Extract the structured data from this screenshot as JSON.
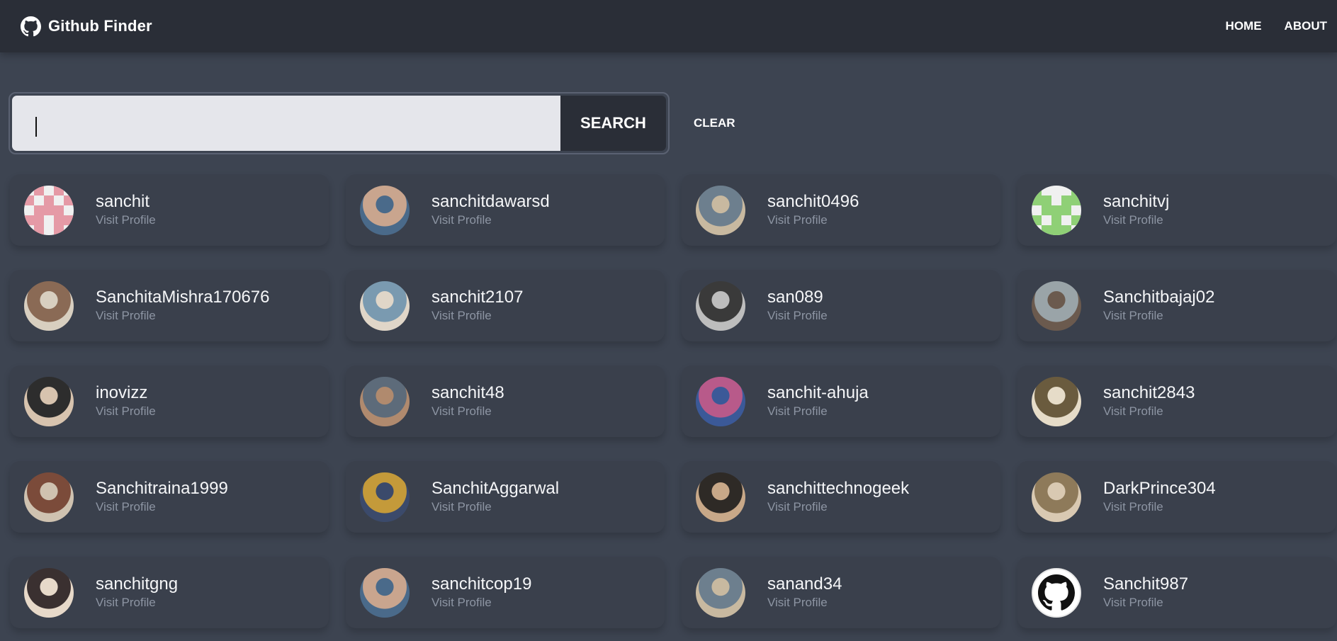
{
  "navbar": {
    "brand_icon": "github-icon",
    "title": "Github Finder",
    "links": [
      "HOME",
      "ABOUT"
    ]
  },
  "search": {
    "value": "",
    "placeholder": "",
    "button_label": "SEARCH",
    "clear_label": "CLEAR"
  },
  "users": [
    {
      "login": "sanchit",
      "link_label": "Visit Profile",
      "avatar": "identicon-pink"
    },
    {
      "login": "sanchitdawarsd",
      "link_label": "Visit Profile",
      "avatar": "photo"
    },
    {
      "login": "sanchit0496",
      "link_label": "Visit Profile",
      "avatar": "photo"
    },
    {
      "login": "sanchitvj",
      "link_label": "Visit Profile",
      "avatar": "identicon-green"
    },
    {
      "login": "SanchitaMishra170676",
      "link_label": "Visit Profile",
      "avatar": "photo"
    },
    {
      "login": "sanchit2107",
      "link_label": "Visit Profile",
      "avatar": "photo"
    },
    {
      "login": "san089",
      "link_label": "Visit Profile",
      "avatar": "photo"
    },
    {
      "login": "Sanchitbajaj02",
      "link_label": "Visit Profile",
      "avatar": "photo"
    },
    {
      "login": "inovizz",
      "link_label": "Visit Profile",
      "avatar": "photo"
    },
    {
      "login": "sanchit48",
      "link_label": "Visit Profile",
      "avatar": "photo"
    },
    {
      "login": "sanchit-ahuja",
      "link_label": "Visit Profile",
      "avatar": "photo"
    },
    {
      "login": "sanchit2843",
      "link_label": "Visit Profile",
      "avatar": "photo"
    },
    {
      "login": "Sanchitraina1999",
      "link_label": "Visit Profile",
      "avatar": "photo"
    },
    {
      "login": "SanchitAggarwal",
      "link_label": "Visit Profile",
      "avatar": "photo"
    },
    {
      "login": "sanchittechnogeek",
      "link_label": "Visit Profile",
      "avatar": "photo"
    },
    {
      "login": "DarkPrince304",
      "link_label": "Visit Profile",
      "avatar": "photo"
    },
    {
      "login": "sanchitgng",
      "link_label": "Visit Profile",
      "avatar": "photo"
    },
    {
      "login": "sanchitcop19",
      "link_label": "Visit Profile",
      "avatar": "photo"
    },
    {
      "login": "sanand34",
      "link_label": "Visit Profile",
      "avatar": "photo"
    },
    {
      "login": "Sanchit987",
      "link_label": "Visit Profile",
      "avatar": "github-icon"
    }
  ],
  "colors": {
    "navbar_bg": "#2a2e37",
    "page_bg": "#3d4451",
    "card_bg": "#3a404c",
    "muted_text": "#8d95a3",
    "input_bg": "#e5e6eb"
  }
}
